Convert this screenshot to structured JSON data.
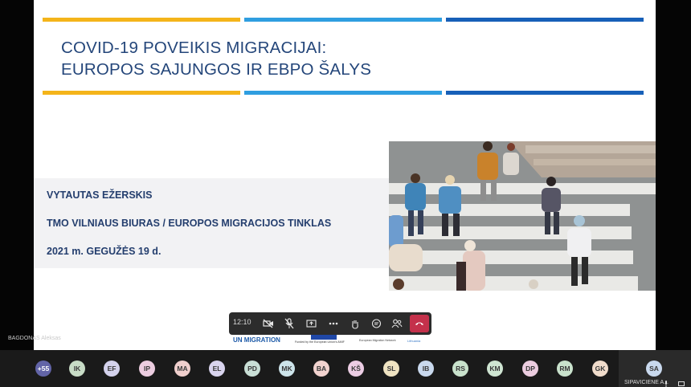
{
  "slide": {
    "title_line1": "COVID-19 POVEIKIS MIGRACIJAI:",
    "title_line2": "EUROPOS SAJUNGOS IR EBPO ŠALYS",
    "presenter": "VYTAUTAS EŽERSKIS",
    "organization": "TMO VILNIAUS BIURAS / EUROPOS MIGRACIJOS TINKLAS",
    "date": "2021 m. GEGUŽĖS 19 d.",
    "bar_colors": [
      "#f4b41a",
      "#2f9ee0",
      "#1760b8"
    ],
    "photo_icon": "crosswalk-pedestrians-photo",
    "logos": {
      "iom": "IOM",
      "iom_sub": "UN MIGRATION",
      "eu_caption": "Funded by the European Union's AMIF",
      "emn": "EMN",
      "emn_sub": "European Migration Network",
      "lt": "Lithuania"
    }
  },
  "toolbar": {
    "time": "12:10",
    "icons": [
      "camera-off-icon",
      "mic-off-icon",
      "share-screen-icon",
      "more-icon",
      "raise-hand-icon",
      "chat-icon",
      "people-icon",
      "hang-up-icon"
    ]
  },
  "speaker_tag": "BAGDONAS Aleksas",
  "participants": [
    {
      "initials": "+55",
      "color": "#6264a7"
    },
    {
      "initials": "IK",
      "color": "#c8dcc6"
    },
    {
      "initials": "EF",
      "color": "#d4d2ec"
    },
    {
      "initials": "IP",
      "color": "#eccde0"
    },
    {
      "initials": "MA",
      "color": "#f0cfcd"
    },
    {
      "initials": "EL",
      "color": "#d9d4ee"
    },
    {
      "initials": "PD",
      "color": "#c9dfd6"
    },
    {
      "initials": "MK",
      "color": "#cde4ea"
    },
    {
      "initials": "BA",
      "color": "#f2d3cf"
    },
    {
      "initials": "KŠ",
      "color": "#eccde4"
    },
    {
      "initials": "SL",
      "color": "#efe3c2"
    },
    {
      "initials": "IB",
      "color": "#c9d9ee"
    },
    {
      "initials": "RS",
      "color": "#c9e2cc"
    },
    {
      "initials": "KM",
      "color": "#cfe5d2"
    },
    {
      "initials": "DP",
      "color": "#eccde0"
    },
    {
      "initials": "RM",
      "color": "#c9e2cc"
    },
    {
      "initials": "GK",
      "color": "#f0dccb"
    }
  ],
  "self": {
    "initials": "SA",
    "name": "SIPAVICIENE A...",
    "color": "#c9d9ee"
  }
}
